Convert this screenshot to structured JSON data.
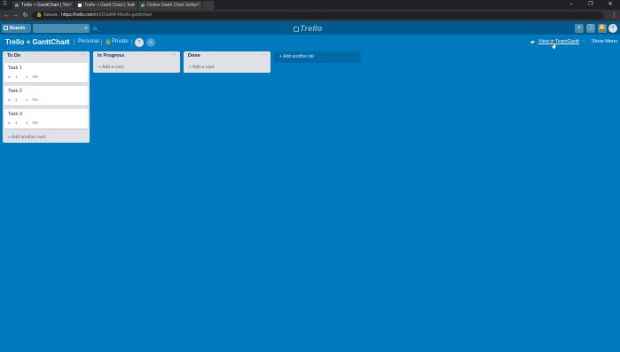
{
  "browser": {
    "tabs": [
      {
        "title": "Trello + GanttChart | Tre",
        "favicon_color": "#4a90e2"
      },
      {
        "title": "Trello + Gantt Chart | Tea",
        "favicon_color": "#ffffff"
      },
      {
        "title": "Online Gantt Chart Softw",
        "favicon_color": "#4caf50"
      }
    ],
    "close_glyph": "×",
    "secure_label": "Secure",
    "url_host": "https://trello.com",
    "url_path": "/b/XD3aRtF4/trello-ganttchart"
  },
  "header": {
    "boards_label": "Boards",
    "logo_text": "Trello",
    "user_initial": "T"
  },
  "board": {
    "title": "Trello + GanttChart",
    "team": "Personal",
    "visibility": "Private",
    "member_initial": "T",
    "view_in_teamgantt": "View in TeamGantt",
    "show_menu": "Show Menu"
  },
  "lists": [
    {
      "title": "To Do",
      "cards": [
        {
          "title": "Task 1",
          "attachments": "1",
          "progress": "0%"
        },
        {
          "title": "Task 2",
          "attachments": "1",
          "progress": "0%"
        },
        {
          "title": "Task 3",
          "attachments": "1",
          "progress": "0%"
        }
      ],
      "add_card": "+ Add another card"
    },
    {
      "title": "In Progress",
      "cards": [],
      "add_card": "+ Add a card"
    },
    {
      "title": "Done",
      "cards": [],
      "add_card": "+ Add a card"
    }
  ],
  "add_list": "+ Add another list",
  "colors": {
    "board_bg": "#0079bf",
    "header_bg": "#005a8d",
    "list_bg": "#dfe1e6"
  }
}
